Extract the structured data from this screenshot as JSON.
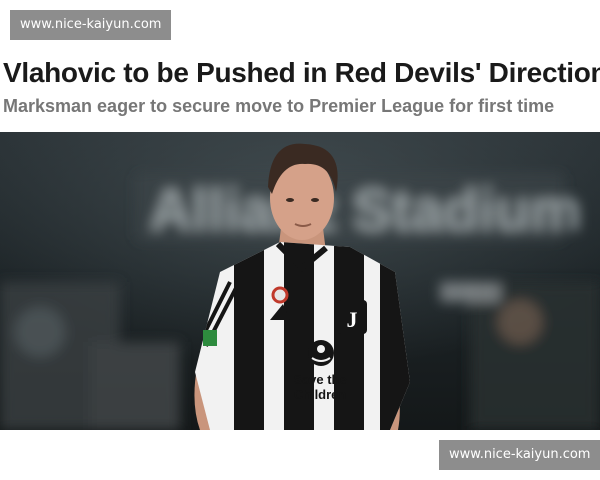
{
  "watermark": {
    "top_text": "www.nice-kaiyun.com",
    "bottom_text": "www.nice-kaiyun.com"
  },
  "article": {
    "headline": "Vlahovic to be Pushed in Red Devils' Direction",
    "subheadline": "Marksman eager to secure move to Premier League for first time"
  },
  "photo": {
    "stadium_sign": "Allianz Stadium",
    "shirt_text_line1": "Save the",
    "shirt_text_line2": "Children",
    "crest_letter": "J"
  },
  "colors": {
    "headline": "#1a1a1a",
    "subheadline": "#777777",
    "watermark_bg": "#8d8d8d"
  }
}
